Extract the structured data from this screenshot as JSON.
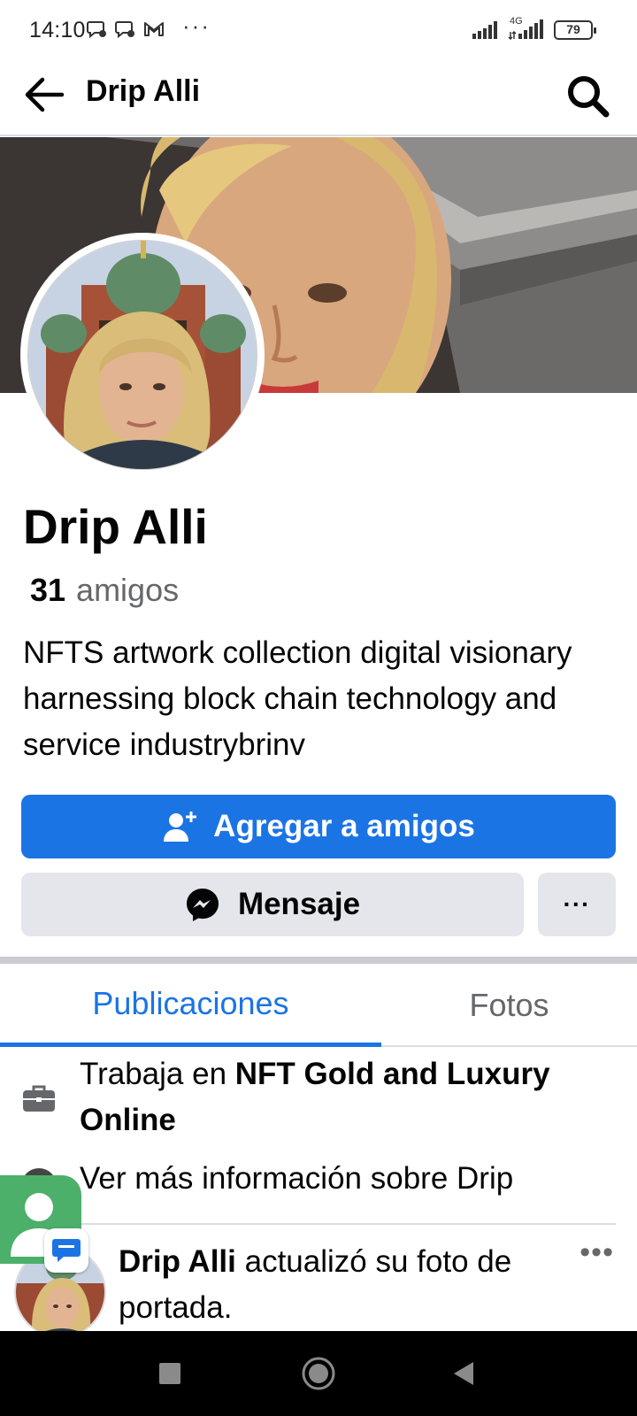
{
  "status_bar": {
    "time": "14:10",
    "network": "4G",
    "battery": "79",
    "overflow": "···"
  },
  "header": {
    "title": "Drip Alli"
  },
  "profile": {
    "name": "Drip Alli",
    "friends_count": "31",
    "friends_label": "amigos",
    "bio": "NFTS artwork collection digital visionary harnessing block chain technology and service industrybrinv"
  },
  "actions": {
    "add_friend": "Agregar a amigos",
    "message": "Mensaje",
    "more": "···"
  },
  "tabs": [
    {
      "label": "Publicaciones",
      "active": true
    },
    {
      "label": "Fotos",
      "active": false
    }
  ],
  "details": {
    "work_prefix": "Trabaja en ",
    "work_place": "NFT Gold and Luxury Online",
    "more_info": "Ver más información sobre Drip"
  },
  "post": {
    "author": "Drip Alli",
    "action": " actualizó su foto de portada.",
    "more": "•••"
  },
  "colors": {
    "accent": "#1b74e4",
    "secondary_button": "#e4e6eb",
    "muted_text": "#65676b"
  }
}
